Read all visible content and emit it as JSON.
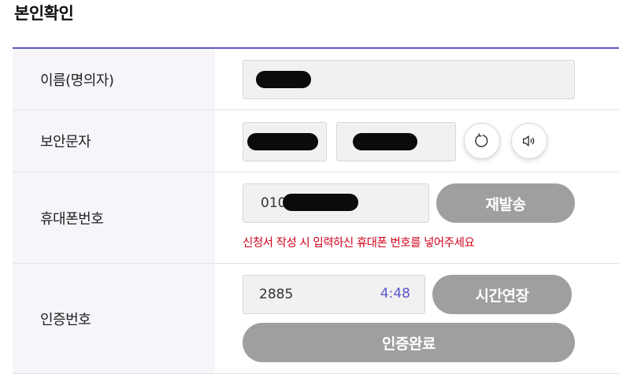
{
  "page": {
    "title": "본인확인"
  },
  "rows": {
    "name": {
      "label": "이름(명의자)"
    },
    "security": {
      "label": "보안문자",
      "refresh_icon": "refresh-icon",
      "audio_icon": "speaker-icon"
    },
    "phone": {
      "label": "휴대폰번호",
      "prefix": "010",
      "resend_label": "재발송",
      "hint": "신청서 작성 시 입력하신 휴대폰 번호를 넣어주세요"
    },
    "code": {
      "label": "인증번호",
      "value": "2885",
      "timer": "4:48",
      "extend_label": "시간연장",
      "complete_label": "인증완료"
    }
  },
  "colors": {
    "accent": "#5b58c9",
    "error": "#d0021b",
    "button": "#9f9f9f"
  }
}
